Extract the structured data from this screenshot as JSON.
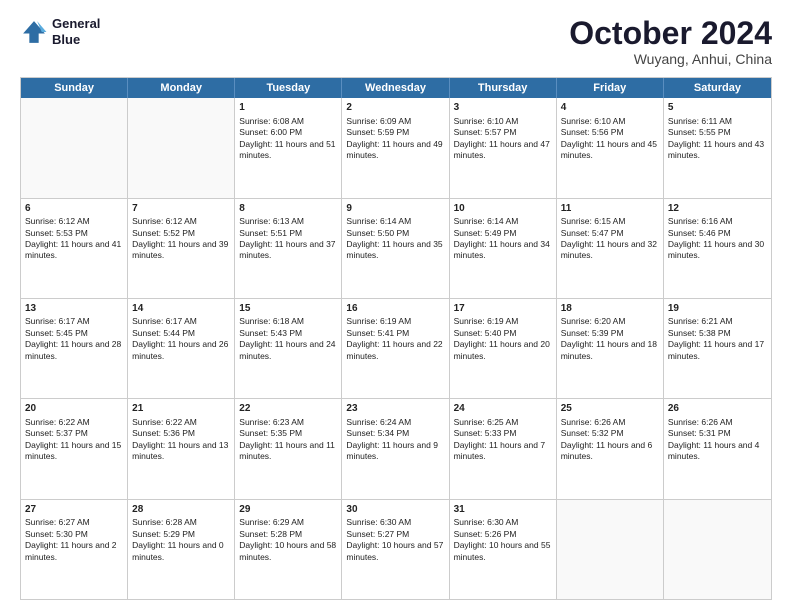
{
  "logo": {
    "line1": "General",
    "line2": "Blue"
  },
  "title": "October 2024",
  "subtitle": "Wuyang, Anhui, China",
  "header_days": [
    "Sunday",
    "Monday",
    "Tuesday",
    "Wednesday",
    "Thursday",
    "Friday",
    "Saturday"
  ],
  "weeks": [
    [
      {
        "day": "",
        "sunrise": "",
        "sunset": "",
        "daylight": ""
      },
      {
        "day": "",
        "sunrise": "",
        "sunset": "",
        "daylight": ""
      },
      {
        "day": "1",
        "sunrise": "Sunrise: 6:08 AM",
        "sunset": "Sunset: 6:00 PM",
        "daylight": "Daylight: 11 hours and 51 minutes."
      },
      {
        "day": "2",
        "sunrise": "Sunrise: 6:09 AM",
        "sunset": "Sunset: 5:59 PM",
        "daylight": "Daylight: 11 hours and 49 minutes."
      },
      {
        "day": "3",
        "sunrise": "Sunrise: 6:10 AM",
        "sunset": "Sunset: 5:57 PM",
        "daylight": "Daylight: 11 hours and 47 minutes."
      },
      {
        "day": "4",
        "sunrise": "Sunrise: 6:10 AM",
        "sunset": "Sunset: 5:56 PM",
        "daylight": "Daylight: 11 hours and 45 minutes."
      },
      {
        "day": "5",
        "sunrise": "Sunrise: 6:11 AM",
        "sunset": "Sunset: 5:55 PM",
        "daylight": "Daylight: 11 hours and 43 minutes."
      }
    ],
    [
      {
        "day": "6",
        "sunrise": "Sunrise: 6:12 AM",
        "sunset": "Sunset: 5:53 PM",
        "daylight": "Daylight: 11 hours and 41 minutes."
      },
      {
        "day": "7",
        "sunrise": "Sunrise: 6:12 AM",
        "sunset": "Sunset: 5:52 PM",
        "daylight": "Daylight: 11 hours and 39 minutes."
      },
      {
        "day": "8",
        "sunrise": "Sunrise: 6:13 AM",
        "sunset": "Sunset: 5:51 PM",
        "daylight": "Daylight: 11 hours and 37 minutes."
      },
      {
        "day": "9",
        "sunrise": "Sunrise: 6:14 AM",
        "sunset": "Sunset: 5:50 PM",
        "daylight": "Daylight: 11 hours and 35 minutes."
      },
      {
        "day": "10",
        "sunrise": "Sunrise: 6:14 AM",
        "sunset": "Sunset: 5:49 PM",
        "daylight": "Daylight: 11 hours and 34 minutes."
      },
      {
        "day": "11",
        "sunrise": "Sunrise: 6:15 AM",
        "sunset": "Sunset: 5:47 PM",
        "daylight": "Daylight: 11 hours and 32 minutes."
      },
      {
        "day": "12",
        "sunrise": "Sunrise: 6:16 AM",
        "sunset": "Sunset: 5:46 PM",
        "daylight": "Daylight: 11 hours and 30 minutes."
      }
    ],
    [
      {
        "day": "13",
        "sunrise": "Sunrise: 6:17 AM",
        "sunset": "Sunset: 5:45 PM",
        "daylight": "Daylight: 11 hours and 28 minutes."
      },
      {
        "day": "14",
        "sunrise": "Sunrise: 6:17 AM",
        "sunset": "Sunset: 5:44 PM",
        "daylight": "Daylight: 11 hours and 26 minutes."
      },
      {
        "day": "15",
        "sunrise": "Sunrise: 6:18 AM",
        "sunset": "Sunset: 5:43 PM",
        "daylight": "Daylight: 11 hours and 24 minutes."
      },
      {
        "day": "16",
        "sunrise": "Sunrise: 6:19 AM",
        "sunset": "Sunset: 5:41 PM",
        "daylight": "Daylight: 11 hours and 22 minutes."
      },
      {
        "day": "17",
        "sunrise": "Sunrise: 6:19 AM",
        "sunset": "Sunset: 5:40 PM",
        "daylight": "Daylight: 11 hours and 20 minutes."
      },
      {
        "day": "18",
        "sunrise": "Sunrise: 6:20 AM",
        "sunset": "Sunset: 5:39 PM",
        "daylight": "Daylight: 11 hours and 18 minutes."
      },
      {
        "day": "19",
        "sunrise": "Sunrise: 6:21 AM",
        "sunset": "Sunset: 5:38 PM",
        "daylight": "Daylight: 11 hours and 17 minutes."
      }
    ],
    [
      {
        "day": "20",
        "sunrise": "Sunrise: 6:22 AM",
        "sunset": "Sunset: 5:37 PM",
        "daylight": "Daylight: 11 hours and 15 minutes."
      },
      {
        "day": "21",
        "sunrise": "Sunrise: 6:22 AM",
        "sunset": "Sunset: 5:36 PM",
        "daylight": "Daylight: 11 hours and 13 minutes."
      },
      {
        "day": "22",
        "sunrise": "Sunrise: 6:23 AM",
        "sunset": "Sunset: 5:35 PM",
        "daylight": "Daylight: 11 hours and 11 minutes."
      },
      {
        "day": "23",
        "sunrise": "Sunrise: 6:24 AM",
        "sunset": "Sunset: 5:34 PM",
        "daylight": "Daylight: 11 hours and 9 minutes."
      },
      {
        "day": "24",
        "sunrise": "Sunrise: 6:25 AM",
        "sunset": "Sunset: 5:33 PM",
        "daylight": "Daylight: 11 hours and 7 minutes."
      },
      {
        "day": "25",
        "sunrise": "Sunrise: 6:26 AM",
        "sunset": "Sunset: 5:32 PM",
        "daylight": "Daylight: 11 hours and 6 minutes."
      },
      {
        "day": "26",
        "sunrise": "Sunrise: 6:26 AM",
        "sunset": "Sunset: 5:31 PM",
        "daylight": "Daylight: 11 hours and 4 minutes."
      }
    ],
    [
      {
        "day": "27",
        "sunrise": "Sunrise: 6:27 AM",
        "sunset": "Sunset: 5:30 PM",
        "daylight": "Daylight: 11 hours and 2 minutes."
      },
      {
        "day": "28",
        "sunrise": "Sunrise: 6:28 AM",
        "sunset": "Sunset: 5:29 PM",
        "daylight": "Daylight: 11 hours and 0 minutes."
      },
      {
        "day": "29",
        "sunrise": "Sunrise: 6:29 AM",
        "sunset": "Sunset: 5:28 PM",
        "daylight": "Daylight: 10 hours and 58 minutes."
      },
      {
        "day": "30",
        "sunrise": "Sunrise: 6:30 AM",
        "sunset": "Sunset: 5:27 PM",
        "daylight": "Daylight: 10 hours and 57 minutes."
      },
      {
        "day": "31",
        "sunrise": "Sunrise: 6:30 AM",
        "sunset": "Sunset: 5:26 PM",
        "daylight": "Daylight: 10 hours and 55 minutes."
      },
      {
        "day": "",
        "sunrise": "",
        "sunset": "",
        "daylight": ""
      },
      {
        "day": "",
        "sunrise": "",
        "sunset": "",
        "daylight": ""
      }
    ]
  ]
}
